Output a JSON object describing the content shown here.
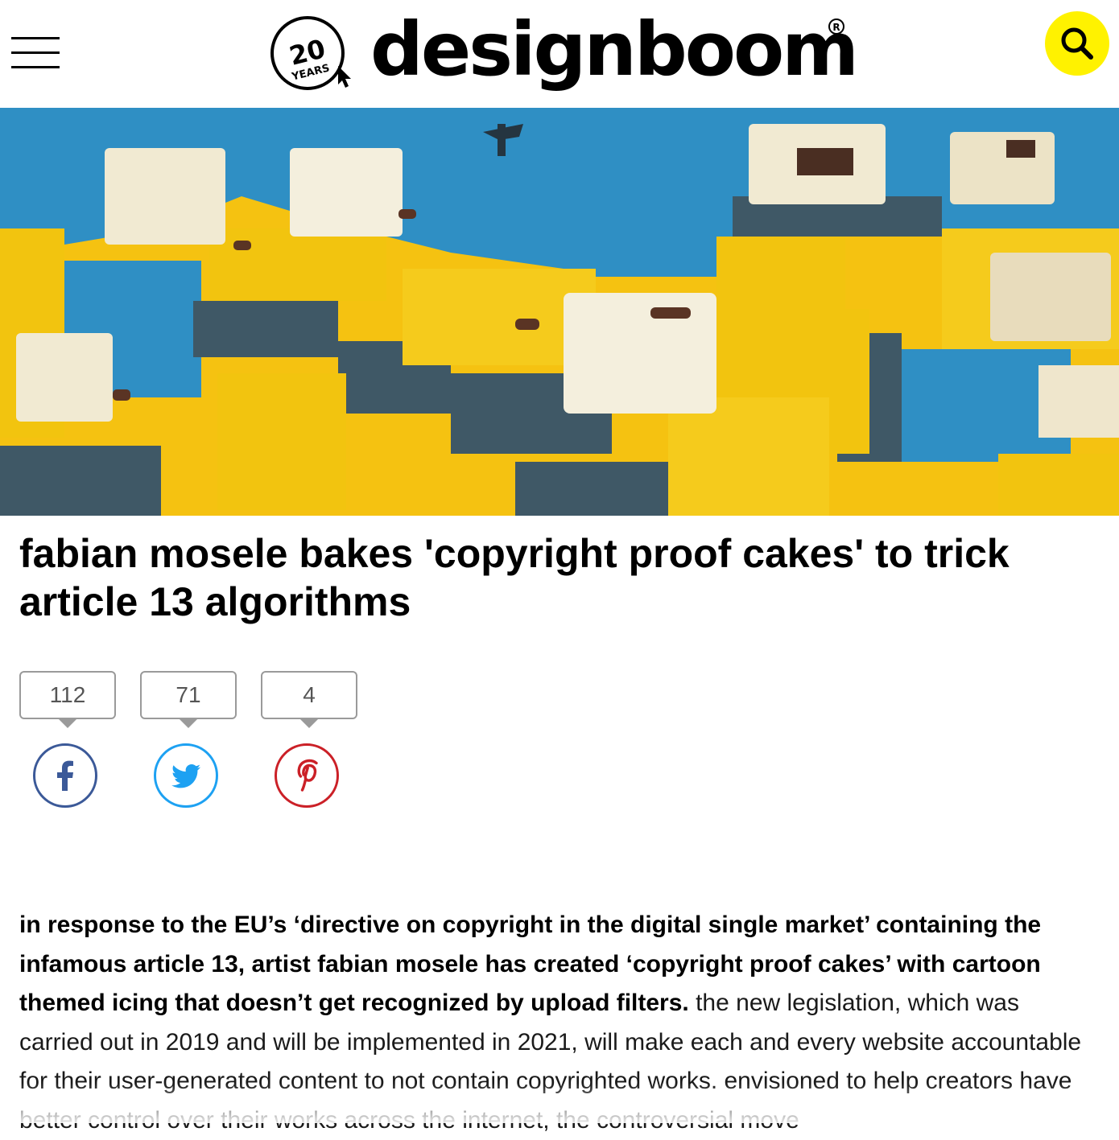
{
  "header": {
    "menu_label": "menu",
    "anniversary_number": "20",
    "anniversary_word": "YEARS",
    "brand": "designboom",
    "search_label": "search"
  },
  "article": {
    "title": "fabian mosele bakes 'copyright proof cakes' to trick article 13 algorithms",
    "intro_bold": "in response to the EU’s ‘directive on copyright in the digital single market’ containing the infamous article 13, artist fabian mosele has created ‘copyright proof cakes’ with cartoon themed icing that doesn’t get recognized by upload filters.",
    "intro_rest": " the new legislation, which was carried out in 2019 and will be implemented in 2021, will make each and every website accountable for their user-generated content to not contain copyrighted works. envisioned to help creators have better control over their works across the internet, the controversial move"
  },
  "share": [
    {
      "network": "facebook",
      "count": "112",
      "icon": "facebook-icon",
      "color": "#3b5998"
    },
    {
      "network": "twitter",
      "count": "71",
      "icon": "twitter-icon",
      "color": "#1da1f2"
    },
    {
      "network": "pinterest",
      "count": "4",
      "icon": "pinterest-icon",
      "color": "#cb2027"
    }
  ],
  "colors": {
    "accent_yellow": "#fff200",
    "hero_yellow": "#f5c211",
    "hero_blue": "#2f8fc4",
    "hero_slate": "#3f5866"
  }
}
